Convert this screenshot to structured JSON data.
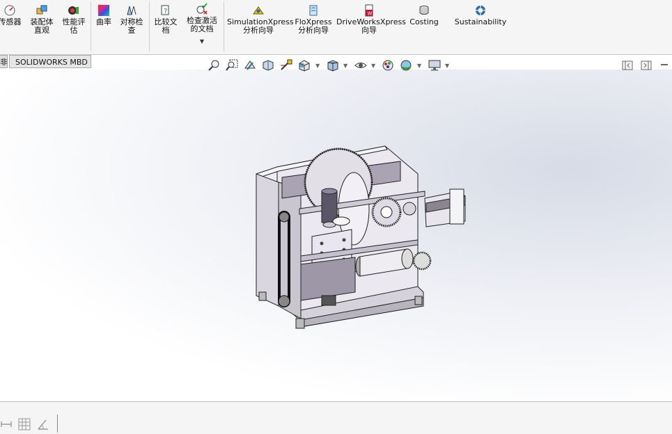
{
  "ribbon": {
    "buttons": [
      {
        "label1": "传感器",
        "label2": ""
      },
      {
        "label1": "装配体",
        "label2": "直观"
      },
      {
        "label1": "性能评",
        "label2": "估"
      },
      {
        "label1": "曲率",
        "label2": ""
      },
      {
        "label1": "对称检",
        "label2": "查"
      },
      {
        "label1": "比较文",
        "label2": "档"
      },
      {
        "label1": "检查激活",
        "label2": "的文档"
      },
      {
        "label1": "SimulationXpress",
        "label2": "分析向导"
      },
      {
        "label1": "FloXpress",
        "label2": "分析向导"
      },
      {
        "label1": "DriveWorksXpress",
        "label2": "向导"
      },
      {
        "label1": "Costing",
        "label2": ""
      },
      {
        "label1": "Sustainability",
        "label2": ""
      }
    ]
  },
  "tabs": {
    "prev_fragment": "非",
    "mbd": "SOLIDWORKS MBD"
  },
  "colors": {
    "accent": "#1f6fb2",
    "curvature": "#e0277a"
  }
}
